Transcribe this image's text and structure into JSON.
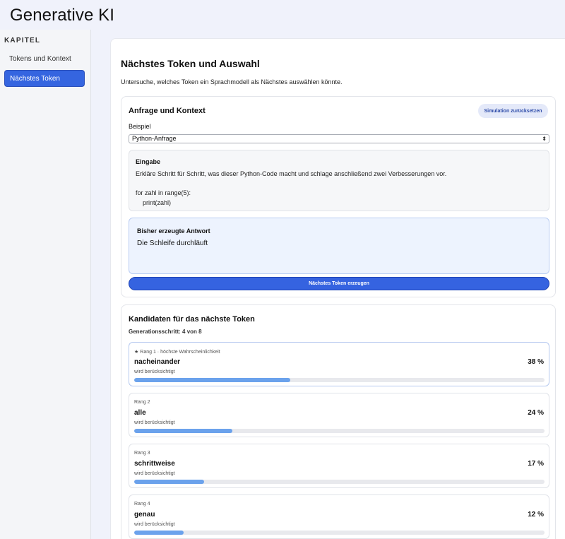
{
  "app": {
    "title": "Generative KI"
  },
  "sidebar": {
    "heading": "KAPITEL",
    "items": [
      {
        "label": "Tokens und Kontext",
        "active": false
      },
      {
        "label": "Nächstes Token",
        "active": true
      }
    ]
  },
  "main": {
    "title": "Nächstes Token und Auswahl",
    "description": "Untersuche, welches Token ein Sprachmodell als Nächstes auswählen könnte."
  },
  "query_panel": {
    "title": "Anfrage und Kontext",
    "reset_label": "Simulation zurücksetzen",
    "example_label": "Beispiel",
    "example_selected": "Python-Anfrage",
    "input_heading": "Eingabe",
    "input_text": "Erkläre Schritt für Schritt, was dieser Python-Code macht und schlage anschließend zwei Verbesserungen vor.\n\nfor zahl in range(5):\n    print(zahl)",
    "answer_heading": "Bisher erzeugte Antwort",
    "answer_text": "Die Schleife durchläuft",
    "generate_label": "Nächstes Token erzeugen"
  },
  "candidates_panel": {
    "title": "Kandidaten für das nächste Token",
    "step_text": "Generationsschritt: 4 von 8",
    "candidates": [
      {
        "rank_label": "Rang 1 · höchste Wahrscheinlichkeit",
        "token": "nacheinander",
        "prob_label": "38 %",
        "prob": 38,
        "status": "wird berücksichtigt",
        "top": true
      },
      {
        "rank_label": "Rang 2",
        "token": "alle",
        "prob_label": "24 %",
        "prob": 24,
        "status": "wird berücksichtigt",
        "top": false
      },
      {
        "rank_label": "Rang 3",
        "token": "schrittweise",
        "prob_label": "17 %",
        "prob": 17,
        "status": "wird berücksichtigt",
        "top": false
      },
      {
        "rank_label": "Rang 4",
        "token": "genau",
        "prob_label": "12 %",
        "prob": 12,
        "status": "wird berücksichtigt",
        "top": false
      }
    ]
  },
  "colors": {
    "accent": "#3563e0",
    "bar_fill": "#6ba2ec",
    "answer_bg": "#edf3fe"
  }
}
